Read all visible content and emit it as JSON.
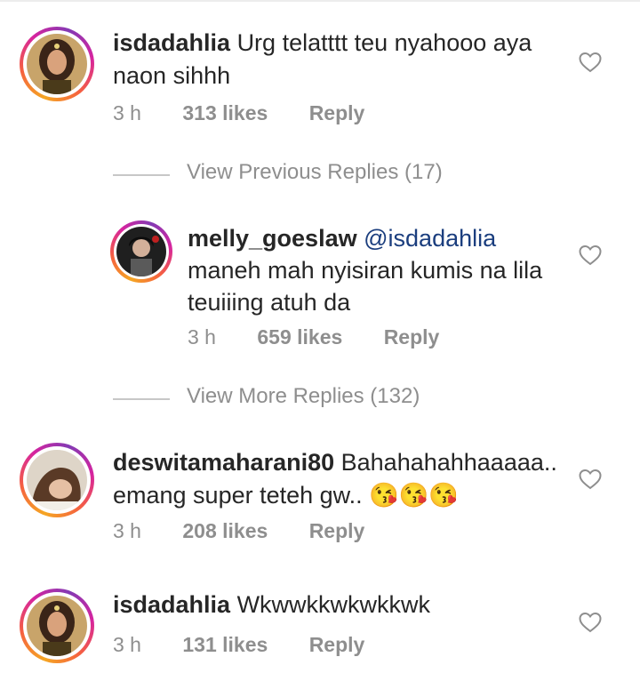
{
  "comments": [
    {
      "username": "isdadahlia",
      "mention": "",
      "text": "Urg telatttt teu nyahooo aya naon sihhh",
      "time": "3 h",
      "likes": "313 likes",
      "reply_label": "Reply",
      "icon": "heart-outline-icon"
    },
    {
      "username": "melly_goeslaw",
      "mention": "@isdadahlia",
      "text": "maneh mah nyisiran kumis na lila teuiiing atuh da",
      "time": "3 h",
      "likes": "659 likes",
      "reply_label": "Reply",
      "icon": "heart-outline-icon"
    },
    {
      "username": "deswitamaharani80",
      "mention": "",
      "text": "Bahahahahhaaaaa.. emang super teteh gw.. 😘😘😘",
      "time": "3 h",
      "likes": "208 likes",
      "reply_label": "Reply",
      "icon": "heart-outline-icon"
    },
    {
      "username": "isdadahlia",
      "mention": "",
      "text": "Wkwwkkwkwkkwk",
      "time": "3 h",
      "likes": "131 likes",
      "reply_label": "Reply",
      "icon": "heart-outline-icon"
    }
  ],
  "view_previous": "View Previous Replies (17)",
  "view_more": "View More Replies (132)",
  "colors": {
    "text": "#262626",
    "meta": "#8e8e8e",
    "mention": "#1b3e7e",
    "ring_start": "#f5a623",
    "ring_end": "#d6249f"
  }
}
